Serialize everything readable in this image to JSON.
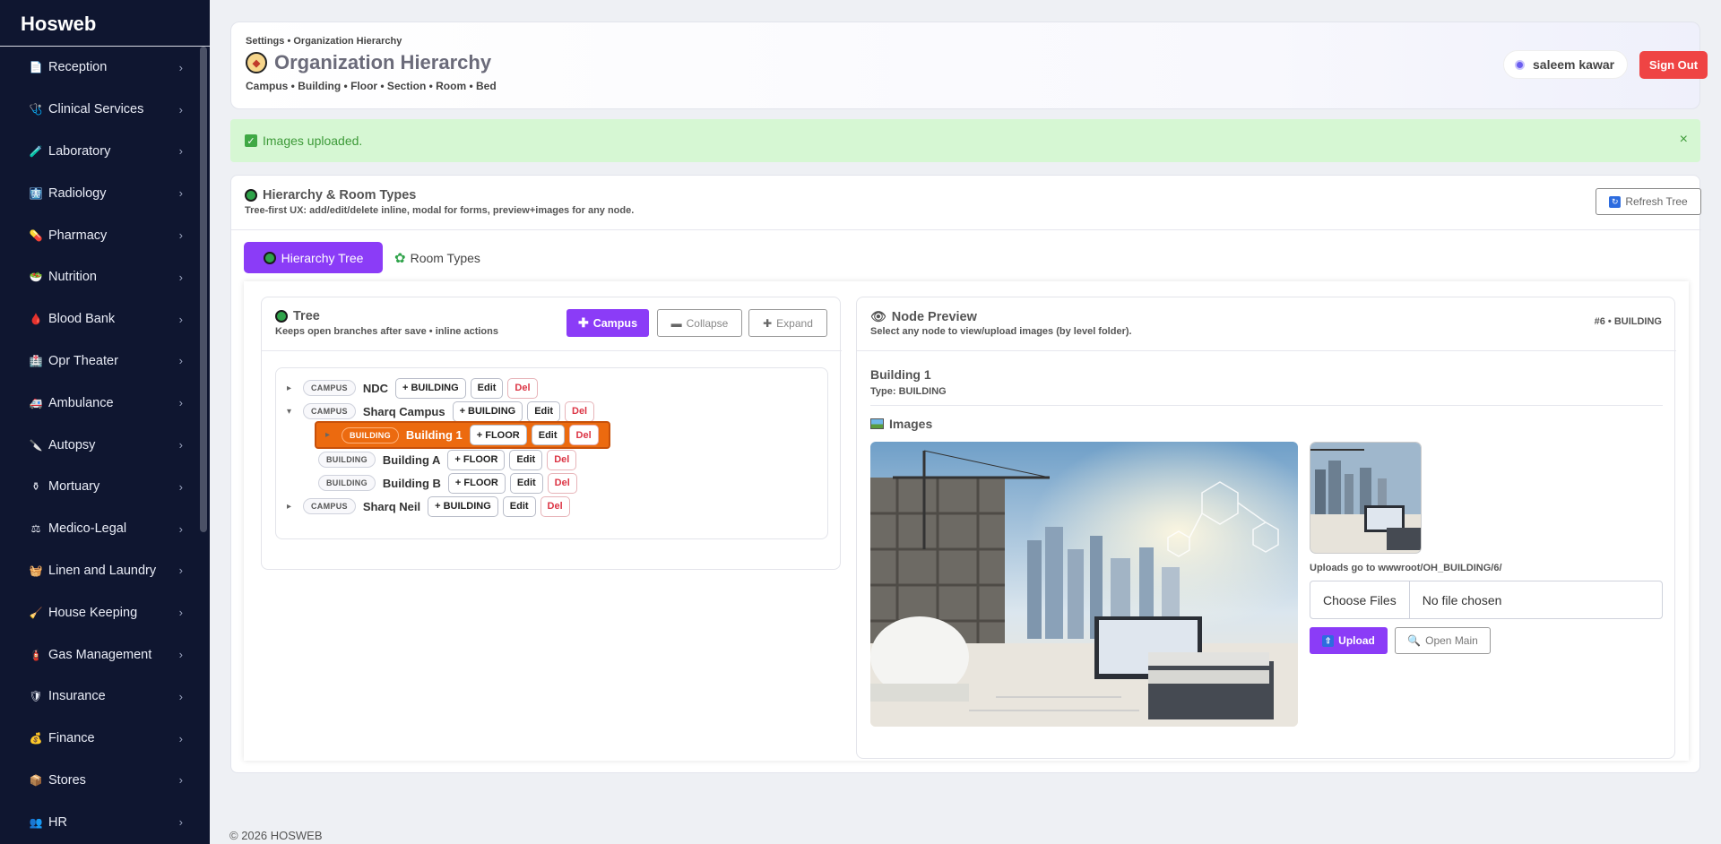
{
  "app": {
    "brand": "Hosweb"
  },
  "sidebar": {
    "items": [
      {
        "label": "Reception",
        "icon": "document-icon",
        "glyph": "📄"
      },
      {
        "label": "Clinical Services",
        "icon": "stethoscope-icon",
        "glyph": "🩺"
      },
      {
        "label": "Laboratory",
        "icon": "test-tube-icon",
        "glyph": "🧪"
      },
      {
        "label": "Radiology",
        "icon": "xray-icon",
        "glyph": "🩻"
      },
      {
        "label": "Pharmacy",
        "icon": "pill-icon",
        "glyph": "💊"
      },
      {
        "label": "Nutrition",
        "icon": "salad-icon",
        "glyph": "🥗"
      },
      {
        "label": "Blood Bank",
        "icon": "blood-drop-icon",
        "glyph": "🩸"
      },
      {
        "label": "Opr Theater",
        "icon": "hospital-icon",
        "glyph": "🏥"
      },
      {
        "label": "Ambulance",
        "icon": "ambulance-icon",
        "glyph": "🚑"
      },
      {
        "label": "Autopsy",
        "icon": "scalpel-icon",
        "glyph": "🔪"
      },
      {
        "label": "Mortuary",
        "icon": "urn-icon",
        "glyph": "⚱"
      },
      {
        "label": "Medico-Legal",
        "icon": "scales-icon",
        "glyph": "⚖"
      },
      {
        "label": "Linen and Laundry",
        "icon": "bucket-icon",
        "glyph": "🧺"
      },
      {
        "label": "House Keeping",
        "icon": "broom-icon",
        "glyph": "🧹"
      },
      {
        "label": "Gas Management",
        "icon": "gas-cylinder-icon",
        "glyph": "🧯"
      },
      {
        "label": "Insurance",
        "icon": "shield-icon",
        "glyph": "🛡"
      },
      {
        "label": "Finance",
        "icon": "money-bag-icon",
        "glyph": "💰"
      },
      {
        "label": "Stores",
        "icon": "box-icon",
        "glyph": "📦"
      },
      {
        "label": "HR",
        "icon": "people-icon",
        "glyph": "👥"
      }
    ]
  },
  "header": {
    "breadcrumb": "Settings • Organization Hierarchy",
    "title": "Organization Hierarchy",
    "subtitle": "Campus • Building • Floor • Section • Room • Bed",
    "user_name": "saleem kawar",
    "signout_label": "Sign Out"
  },
  "alert": {
    "message": "Images uploaded.",
    "close": "×"
  },
  "panel": {
    "title": "Hierarchy & Room Types",
    "subtitle": "Tree-first UX: add/edit/delete inline, modal for forms, preview+images for any node.",
    "refresh_label": "Refresh Tree",
    "tabs": [
      {
        "label": "Hierarchy Tree",
        "active": true
      },
      {
        "label": "Room Types",
        "active": false
      }
    ]
  },
  "tree": {
    "title": "Tree",
    "subtitle": "Keeps open branches after save • inline actions",
    "campus_btn": "Campus",
    "collapse_btn": "Collapse",
    "expand_btn": "Expand",
    "edit_label": "Edit",
    "del_label": "Del",
    "nodes": [
      {
        "level": "CAMPUS",
        "name": "NDC",
        "add": "+ BUILDING",
        "caret": "▸",
        "depth": 0
      },
      {
        "level": "CAMPUS",
        "name": "Sharq Campus",
        "add": "+ BUILDING",
        "caret": "▾",
        "depth": 0
      },
      {
        "level": "BUILDING",
        "name": "Building 1",
        "add": "+ FLOOR",
        "caret": "▸",
        "depth": 1,
        "selected": true
      },
      {
        "level": "BUILDING",
        "name": "Building A",
        "add": "+ FLOOR",
        "caret": "",
        "depth": 1
      },
      {
        "level": "BUILDING",
        "name": "Building B",
        "add": "+ FLOOR",
        "caret": "",
        "depth": 1
      },
      {
        "level": "CAMPUS",
        "name": "Sharq Neil",
        "add": "+ BUILDING",
        "caret": "▸",
        "depth": 0
      }
    ]
  },
  "preview": {
    "title": "Node Preview",
    "subtitle": "Select any node to view/upload images (by level folder).",
    "node_id": "#6 • BUILDING",
    "name": "Building 1",
    "type": "Type: BUILDING",
    "images_title": "Images",
    "upload_note": "Uploads go to wwwroot/OH_BUILDING/6/",
    "choose_files": "Choose Files",
    "no_file": "No file chosen",
    "upload_btn": "Upload",
    "open_main_btn": "Open Main"
  },
  "footer": {
    "text": "© 2026 HOSWEB"
  }
}
